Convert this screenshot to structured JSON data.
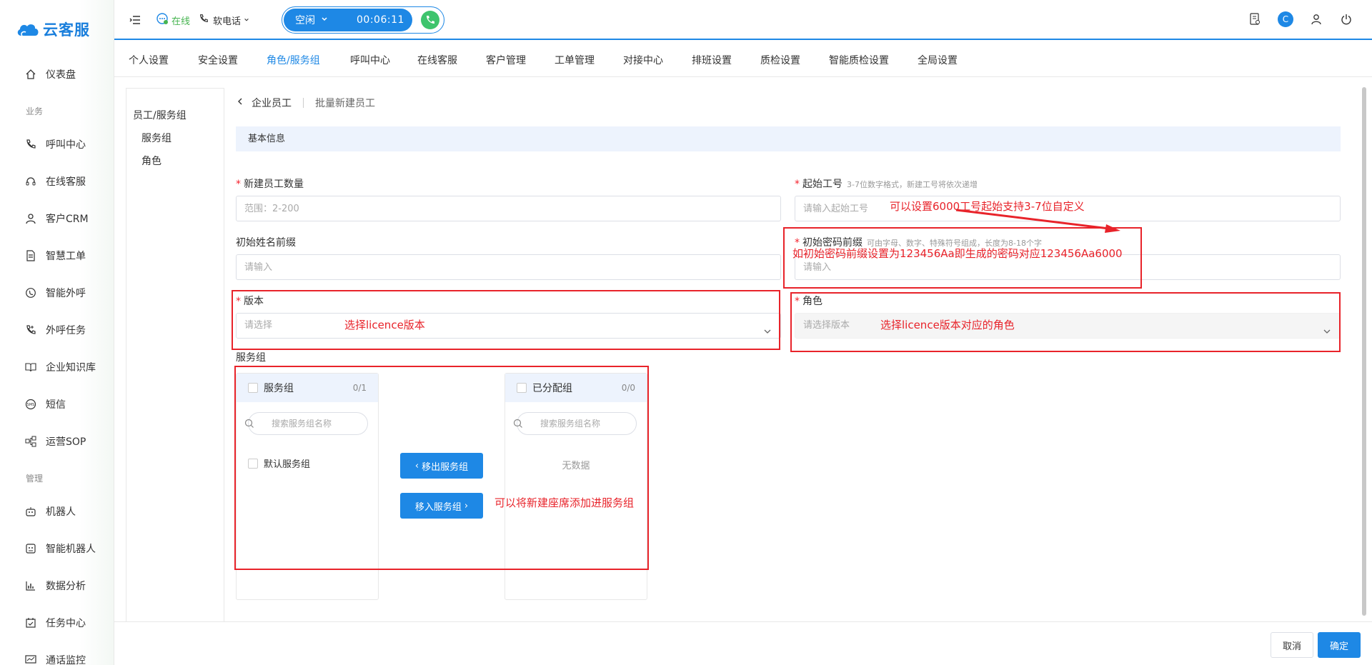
{
  "app": {
    "name": "云客服",
    "brand_color": "#1e88e5"
  },
  "sidebar": {
    "items": [
      {
        "label": "仪表盘",
        "icon": "home-icon"
      },
      {
        "label": "呼叫中心",
        "icon": "phone-icon"
      },
      {
        "label": "在线客服",
        "icon": "headset-icon"
      },
      {
        "label": "客户CRM",
        "icon": "user-icon"
      },
      {
        "label": "智慧工单",
        "icon": "document-icon"
      },
      {
        "label": "智能外呼",
        "icon": "whatsapp-phone-icon"
      },
      {
        "label": "外呼任务",
        "icon": "phone-task-icon"
      },
      {
        "label": "企业知识库",
        "icon": "book-icon"
      },
      {
        "label": "短信",
        "icon": "sms-icon"
      },
      {
        "label": "运营SOP",
        "icon": "flow-icon"
      },
      {
        "label": "机器人",
        "icon": "robot-icon"
      },
      {
        "label": "智能机器人",
        "icon": "smart-robot-icon"
      },
      {
        "label": "数据分析",
        "icon": "chart-icon"
      },
      {
        "label": "任务中心",
        "icon": "task-icon"
      },
      {
        "label": "通话监控",
        "icon": "monitor-icon"
      }
    ],
    "section_business": "业务",
    "section_manage": "管理"
  },
  "header": {
    "status": "在线",
    "phone_mode": "软电话",
    "call_state": "空闲",
    "call_timer": "00:06:11",
    "avatar_letter": "C"
  },
  "tabs": [
    {
      "label": "个人设置",
      "active": false
    },
    {
      "label": "安全设置",
      "active": false
    },
    {
      "label": "角色/服务组",
      "active": true
    },
    {
      "label": "呼叫中心",
      "active": false
    },
    {
      "label": "在线客服",
      "active": false
    },
    {
      "label": "客户管理",
      "active": false
    },
    {
      "label": "工单管理",
      "active": false
    },
    {
      "label": "对接中心",
      "active": false
    },
    {
      "label": "排班设置",
      "active": false
    },
    {
      "label": "质检设置",
      "active": false
    },
    {
      "label": "智能质检设置",
      "active": false
    },
    {
      "label": "全局设置",
      "active": false
    }
  ],
  "subnav": {
    "title": "员工/服务组",
    "items": [
      "服务组",
      "角色"
    ]
  },
  "breadcrumb": {
    "parent": "企业员工",
    "current": "批量新建员工"
  },
  "form": {
    "section": "基本信息",
    "count_label": "新建员工数量",
    "count_placeholder": "范围：2-200",
    "start_no_label": "起始工号",
    "start_no_hint": "3-7位数字格式，新建工号将依次递增",
    "start_no_placeholder": "请输入起始工号",
    "name_prefix_label": "初始姓名前缀",
    "name_prefix_placeholder": "请输入",
    "pwd_prefix_label": "初始密码前缀",
    "pwd_prefix_hint": "可由字母、数字、特殊符号组成，长度为8-18个字",
    "pwd_prefix_placeholder": "请输入",
    "version_label": "版本",
    "version_placeholder": "请选择",
    "role_label": "角色",
    "role_placeholder": "请选择版本",
    "group_label": "服务组"
  },
  "transfer": {
    "left_title": "服务组",
    "left_count": "0/1",
    "left_search_placeholder": "搜索服务组名称",
    "left_items": [
      "默认服务组"
    ],
    "right_title": "已分配组",
    "right_count": "0/0",
    "right_search_placeholder": "搜索服务组名称",
    "right_empty": "无数据",
    "btn_remove": "移出服务组",
    "btn_add": "移入服务组"
  },
  "annotations": {
    "start_no": "可以设置6000工号起始支持3-7位自定义",
    "password": "如初始密码前缀设置为123456Aa即生成的密码对应123456Aa6000",
    "version": "选择licence版本",
    "role": "选择licence版本对应的角色",
    "group": "可以将新建座席添加进服务组"
  },
  "footer": {
    "cancel": "取消",
    "confirm": "确定"
  }
}
